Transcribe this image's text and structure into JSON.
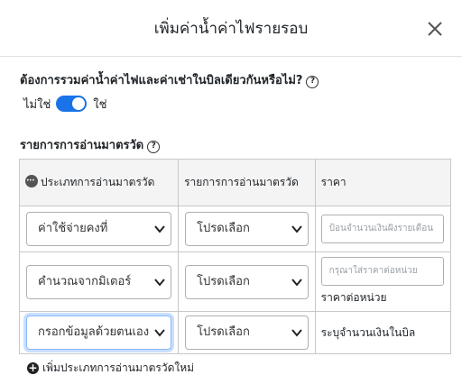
{
  "modal": {
    "title": "เพิ่มค่าน้ำค่าไฟรายรอบ",
    "close_icon": "close-icon"
  },
  "combine_question": {
    "label": "ต้องการรวมค่าน้ำค่าไฟและค่าเช่าในบิลเดียวกันหรือไม่?",
    "help": "?",
    "toggle": {
      "off_label": "ไม่ใช่",
      "on_label": "ใช่",
      "state": "on"
    },
    "accent": "#1a73e8"
  },
  "meters_section": {
    "label": "รายการการอ่านมาตรวัด",
    "help": "?",
    "columns": [
      "ประเภทการอ่านมาตรวัด",
      "รายการการอ่านมาตรวัด",
      "ราคา"
    ],
    "rows": [
      {
        "type": "ค่าใช้จ่ายคงที่",
        "item": "โปรดเลือก",
        "price_placeholder": "ป้อนจำนวนเงินฝังรายเดือน",
        "price_note": ""
      },
      {
        "type": "คำนวณจากมิเตอร์",
        "item": "โปรดเลือก",
        "price_placeholder": "กรุณาใส่ราคาต่อหน่วย",
        "price_note": "ราคาต่อหน่วย"
      },
      {
        "type": "กรอกข้อมูลด้วยตนเอง",
        "item": "โปรดเลือก",
        "price_placeholder": "",
        "price_note": "ระบุจำนวนเงินในบิล"
      }
    ],
    "add_label": "เพิ่มประเภทการอ่านมาตรวัดใหม่"
  }
}
